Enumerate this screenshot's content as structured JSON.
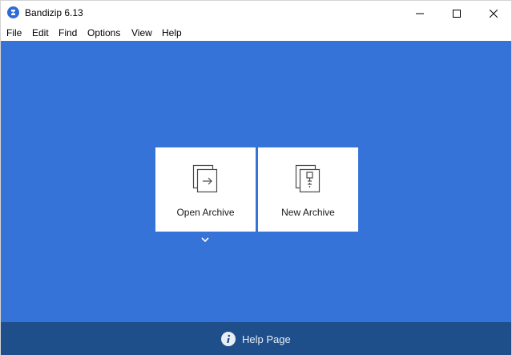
{
  "window": {
    "title": "Bandizip 6.13",
    "app_icon": "bandizip-logo-icon",
    "controls": [
      "minimize-icon",
      "maximize-icon",
      "close-icon"
    ]
  },
  "menubar": {
    "items": [
      {
        "label": "File"
      },
      {
        "label": "Edit"
      },
      {
        "label": "Find"
      },
      {
        "label": "Options"
      },
      {
        "label": "View"
      },
      {
        "label": "Help"
      }
    ]
  },
  "main": {
    "background": "#3673d8",
    "tiles": [
      {
        "label": "Open Archive",
        "icon": "open-archive-icon"
      },
      {
        "label": "New Archive",
        "icon": "new-archive-icon"
      }
    ],
    "dropdown_icon": "chevron-down-icon"
  },
  "footer": {
    "background": "#1e4f8b",
    "help_label": "Help Page",
    "help_icon": "info-icon"
  }
}
